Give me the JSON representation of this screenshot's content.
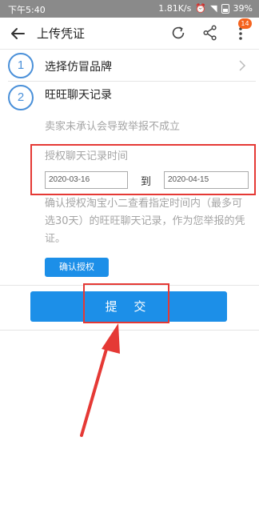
{
  "status_bar": {
    "time": "下午5:40",
    "network": "1.81K/s",
    "battery": "39%"
  },
  "app_bar": {
    "title": "上传凭证",
    "badge_count": "14"
  },
  "steps": [
    {
      "number": "1",
      "label": "选择仿冒品牌"
    },
    {
      "number": "2",
      "label": "旺旺聊天记录"
    }
  ],
  "chat_section": {
    "note": "卖家未承认会导致举报不成立",
    "time_title": "授权聊天记录时间",
    "start_date": "2020-03-16",
    "to_label": "到",
    "end_date": "2020-04-15",
    "description": "确认授权淘宝小二查看指定时间内（最多可选30天）的旺旺聊天记录，作为您举报的凭证。",
    "confirm_button": "确认授权"
  },
  "submit_button": "提 交",
  "colors": {
    "accent": "#1c8fe8",
    "highlight": "#e53935",
    "step_ring": "#4a90d9"
  }
}
